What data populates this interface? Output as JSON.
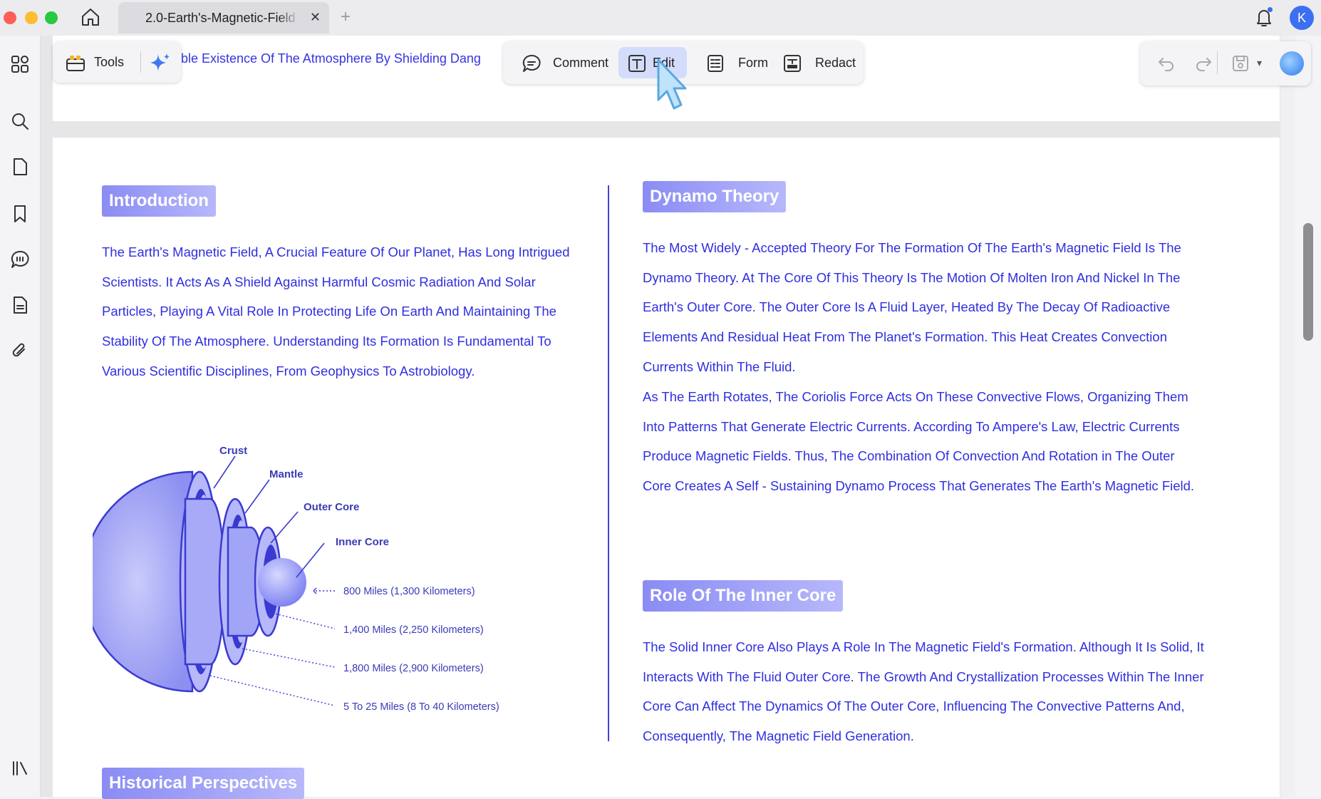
{
  "window": {
    "tab_title": "2.0-Earth's-Magnetic-Field",
    "tab_close": "✕",
    "new_tab": "+",
    "avatar_initial": "K"
  },
  "toolbar": {
    "tools_label": "Tools",
    "header_text": "ble Existence Of The Atmosphere By Shielding Dang",
    "modes": {
      "comment": "Comment",
      "edit": "Edit",
      "form": "Form",
      "redact": "Redact"
    },
    "active_mode": "edit"
  },
  "sidebar": {
    "items": [
      "thumbnails-icon",
      "search-icon",
      "pages-icon",
      "bookmark-icon",
      "comment-list-icon",
      "document-icon",
      "attachment-icon",
      "panel-toggle-icon"
    ]
  },
  "colors": {
    "accent": "#3535e0",
    "heading_bg": "#8a8cf4",
    "edit_active": "#d4dcfb"
  },
  "document": {
    "introduction": {
      "heading": "Introduction",
      "body": "The Earth's Magnetic Field, A Crucial Feature Of Our Planet, Has Long Intrigued Scientists. It Acts As A Shield Against Harmful Cosmic Radiation And Solar Particles, Playing A Vital Role In Protecting Life On Earth And Maintaining The Stability Of The Atmosphere. Understanding Its Formation Is Fundamental To Various Scientific Disciplines, From Geophysics To Astrobiology."
    },
    "diagram": {
      "labels": {
        "crust": "Crust",
        "mantle": "Mantle",
        "outer_core": "Outer Core",
        "inner_core": "Inner Core"
      },
      "measurements": [
        "800 Miles (1,300 Kilometers)",
        "1,400 Miles (2,250 Kilometers)",
        "1,800 Miles (2,900 Kilometers)",
        "5 To 25 Miles (8 To 40 Kilometers)"
      ]
    },
    "dynamo": {
      "heading": "Dynamo Theory",
      "body1": "The Most Widely - Accepted Theory For The Formation Of The Earth's Magnetic Field Is The Dynamo Theory. At The Core Of This Theory Is The Motion Of Molten Iron And Nickel In The Earth's Outer Core. The Outer Core Is A Fluid Layer, Heated By The Decay Of Radioactive Elements And Residual Heat From The Planet's Formation. This Heat Creates Convection Currents Within The Fluid.",
      "body2": "As The Earth Rotates, The Coriolis Force Acts On These Convective Flows, Organizing Them Into Patterns That Generate Electric Currents. According To Ampere's Law, Electric Currents Produce Magnetic Fields. Thus, The Combination Of Convection And Rotation in The Outer Core Creates A Self - Sustaining Dynamo Process That Generates The Earth's Magnetic Field."
    },
    "inner_core": {
      "heading": "Role Of The Inner Core",
      "body": "The Solid Inner Core Also Plays A Role In The Magnetic Field's Formation. Although It Is Solid, It Interacts With The Fluid Outer Core. The Growth And Crystallization Processes Within The Inner Core Can Affect The Dynamics Of The Outer Core, Influencing The Convective Patterns And, Consequently, The Magnetic Field Generation."
    },
    "historical": {
      "heading": "Historical Perspectives"
    }
  }
}
